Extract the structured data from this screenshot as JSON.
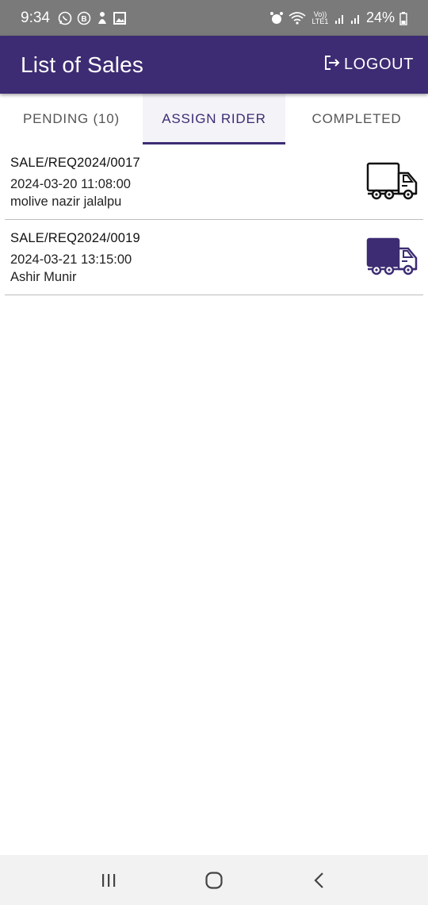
{
  "status_bar": {
    "time": "9:34",
    "battery": "24%",
    "network_label": "Vo)) LTE1",
    "icons": [
      "whatsapp-icon",
      "b-icon",
      "notification-icon",
      "gallery-icon",
      "alarm-icon",
      "wifi-icon",
      "signal-icon",
      "signal-icon",
      "battery-icon"
    ]
  },
  "app_bar": {
    "title": "List of Sales",
    "logout_label": "LOGOUT"
  },
  "tabs": [
    {
      "label": "PENDING (10)",
      "active": false
    },
    {
      "label": "ASSIGN RIDER",
      "active": true
    },
    {
      "label": "COMPLETED",
      "active": false
    }
  ],
  "sales": [
    {
      "number": "SALE/REQ2024/0017",
      "datetime": "2024-03-20 11:08:00",
      "customer": "molive nazir jalalpu",
      "truck_icon": "truck-outline-icon"
    },
    {
      "number": "SALE/REQ2024/0019",
      "datetime": "2024-03-21 13:15:00",
      "customer": "Ashir Munir",
      "truck_icon": "truck-filled-icon"
    }
  ],
  "colors": {
    "primary": "#3d2c73",
    "status_bar": "#7a7a7a",
    "divider": "#bdbdbd",
    "nav_bar": "#f2f2f2"
  },
  "nav_bar": {
    "icons": [
      "recent-apps-icon",
      "home-icon",
      "back-icon"
    ]
  }
}
